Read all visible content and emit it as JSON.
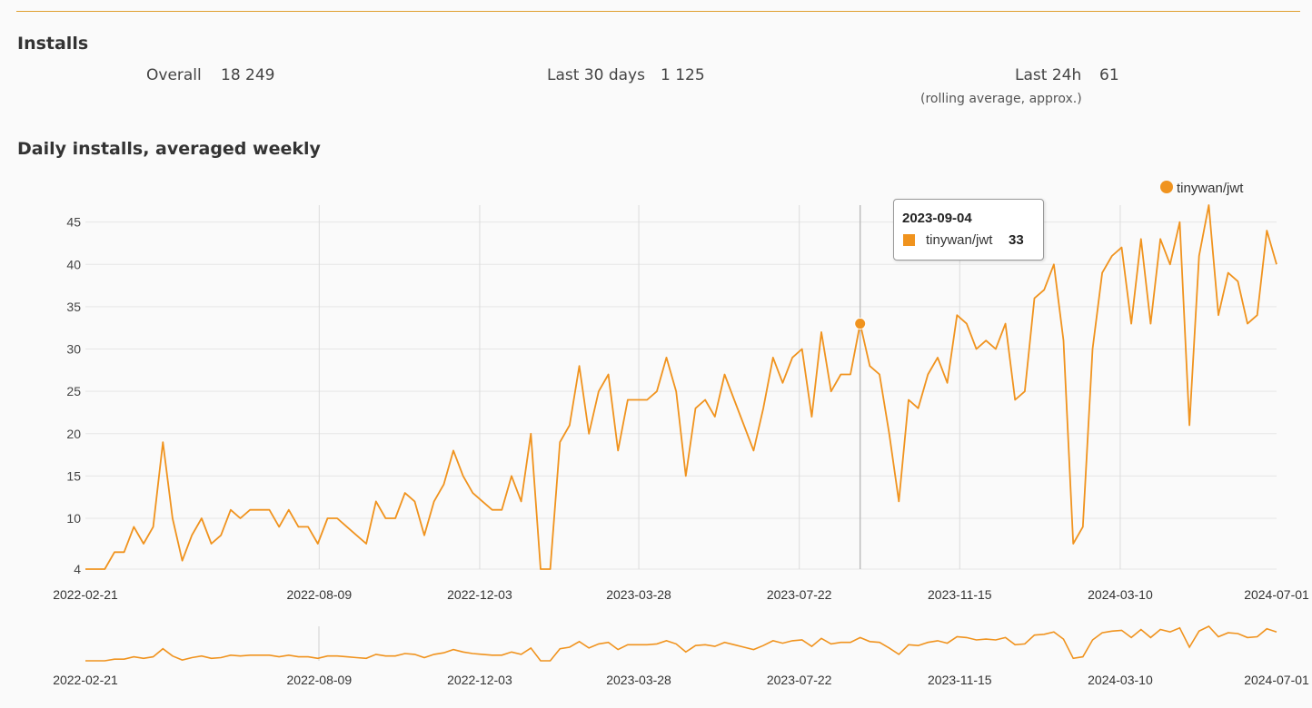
{
  "installs": {
    "title": "Installs",
    "overall_label": "Overall",
    "overall_value": "18 249",
    "last30_label": "Last 30 days",
    "last30_value": "1 125",
    "last24_label": "Last 24h",
    "last24_value": "61",
    "last24_note": "(rolling average, approx.)"
  },
  "daily": {
    "title": "Daily installs, averaged weekly"
  },
  "tooltip": {
    "date": "2023-09-04",
    "series": "tinywan/jwt",
    "value": "33"
  },
  "colors": {
    "series": "#f0931e",
    "accent_rule": "#e0a030"
  },
  "chart_data": {
    "type": "line",
    "title": "Daily installs, averaged weekly",
    "xlabel": "",
    "ylabel": "",
    "ylim": [
      4,
      47
    ],
    "yticks": [
      4,
      10,
      15,
      20,
      25,
      30,
      35,
      40,
      45
    ],
    "x_tick_labels": [
      "2022-02-21",
      "2022-08-09",
      "2022-12-03",
      "2023-03-28",
      "2023-07-22",
      "2023-11-15",
      "2024-03-10",
      "2024-07-01"
    ],
    "legend": "top-right",
    "grid": true,
    "x_start": "2022-02-21",
    "x_step_days": 7,
    "series": [
      {
        "name": "tinywan/jwt",
        "values": [
          4,
          4,
          4,
          6,
          6,
          9,
          7,
          9,
          19,
          10,
          5,
          8,
          10,
          7,
          8,
          11,
          10,
          11,
          11,
          11,
          9,
          11,
          9,
          9,
          7,
          10,
          10,
          9,
          8,
          7,
          12,
          10,
          10,
          13,
          12,
          8,
          12,
          14,
          18,
          15,
          13,
          12,
          11,
          11,
          15,
          12,
          20,
          4,
          4,
          19,
          21,
          28,
          20,
          25,
          27,
          18,
          24,
          24,
          24,
          25,
          29,
          25,
          15,
          23,
          24,
          22,
          27,
          24,
          21,
          18,
          23,
          29,
          26,
          29,
          30,
          22,
          32,
          25,
          27,
          27,
          33,
          28,
          27,
          20,
          12,
          24,
          23,
          27,
          29,
          26,
          34,
          33,
          30,
          31,
          30,
          33,
          24,
          25,
          36,
          37,
          40,
          31,
          7,
          9,
          30,
          39,
          41,
          42,
          33,
          43,
          33,
          43,
          40,
          45,
          21,
          41,
          47,
          34,
          39,
          38,
          33,
          34,
          44,
          40
        ]
      }
    ],
    "highlight": {
      "date": "2023-09-04",
      "value": 33
    }
  }
}
